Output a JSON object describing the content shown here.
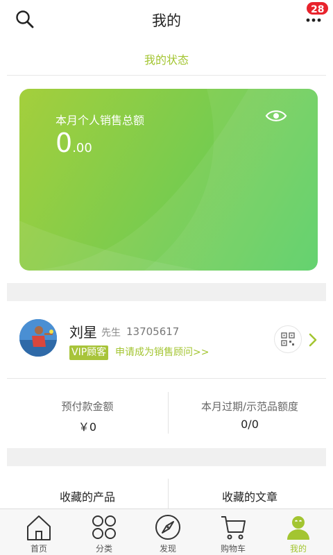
{
  "header": {
    "title": "我的",
    "badge_count": "28"
  },
  "status_section": {
    "title": "我的状态"
  },
  "sales_card": {
    "label": "本月个人销售总额",
    "amount_int": "0",
    "amount_dec": ".00"
  },
  "profile": {
    "name": "刘星",
    "suffix": "先生",
    "phone": "13705617",
    "vip_label": "VIP顾客",
    "apply_link": "申请成为销售顾问>>"
  },
  "stats": [
    {
      "label": "预付款金额",
      "value": "￥0"
    },
    {
      "label": "本月过期/示范品额度",
      "value": "0/0"
    }
  ],
  "favorites": [
    {
      "label": "收藏的产品"
    },
    {
      "label": "收藏的文章"
    }
  ],
  "tabs": [
    {
      "label": "首页",
      "icon": "home-icon"
    },
    {
      "label": "分类",
      "icon": "category-icon"
    },
    {
      "label": "发现",
      "icon": "compass-icon"
    },
    {
      "label": "购物车",
      "icon": "cart-icon"
    },
    {
      "label": "我的",
      "icon": "user-icon",
      "active": true
    }
  ],
  "colors": {
    "accent": "#a3c531",
    "badge": "#e8232c",
    "card_start": "#a4cf3c",
    "card_end": "#4fcd5d"
  }
}
